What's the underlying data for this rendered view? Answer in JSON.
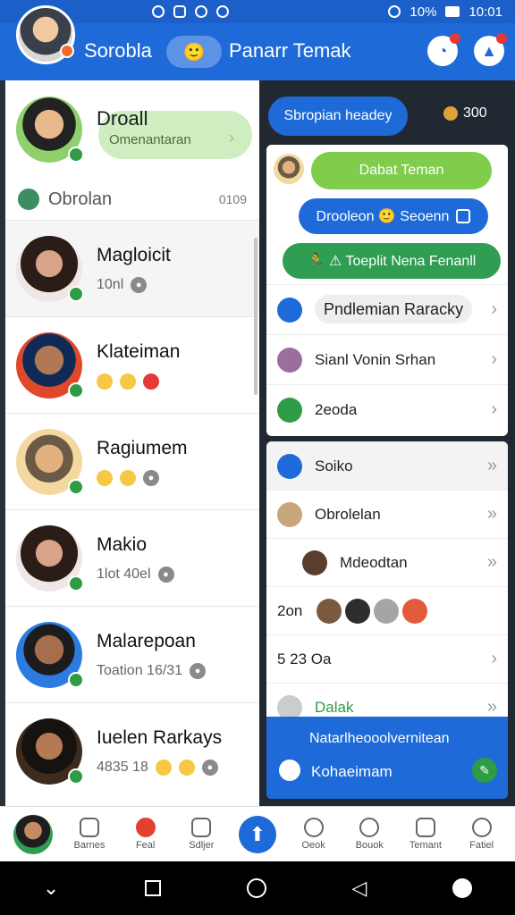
{
  "status_bar": {
    "battery": "10%",
    "time": "10:01"
  },
  "app_bar": {
    "title": "Sorobla",
    "pill_emoji": "🙂",
    "subtitle": "Panarr Temak"
  },
  "me": {
    "name": "Droall",
    "status": "Omenantaran"
  },
  "section": {
    "label": "Obrolan",
    "count": "0109"
  },
  "chats": [
    {
      "name": "Magloicit",
      "meta": "10nl"
    },
    {
      "name": "Klateiman",
      "meta": ""
    },
    {
      "name": "Ragiumem",
      "meta": ""
    },
    {
      "name": "Makio",
      "meta": "1lot 40el"
    },
    {
      "name": "Malarepoan",
      "meta": "Toation 16/31"
    },
    {
      "name": "Iuelen Rarkays",
      "meta": "4835 18"
    }
  ],
  "right": {
    "top_pill": "Sbropian headey",
    "coins": "300",
    "bubbles": [
      "Dabat Teman",
      "Drooleon 🙂 Seoenn",
      "🏃  ⚠  Toeplit Nena Fenanll"
    ],
    "card1_rows": [
      {
        "label": "Pndlemian Raracky"
      },
      {
        "label": "Sianl Vonin Srhan"
      },
      {
        "label": "2eoda"
      }
    ],
    "card2": {
      "header": "Soiko",
      "rows": [
        {
          "label": "Obrolelan"
        },
        {
          "label": "Mdeodtan"
        },
        {
          "label": "2on"
        },
        {
          "label": "5 23   Oa"
        },
        {
          "label": "Dalak"
        }
      ],
      "footer_title": "Natarlheooolvernitean",
      "footer_sub": "Kohaeimam"
    }
  },
  "bottom_nav": [
    "Barnes",
    "Feal",
    "Sdljer",
    "",
    "Oeok",
    "Bouok",
    "Temant",
    "Fatiel"
  ],
  "colors": {
    "primary": "#1e6ad8",
    "green": "#2e9b45",
    "light_green": "#7fcd4b"
  }
}
